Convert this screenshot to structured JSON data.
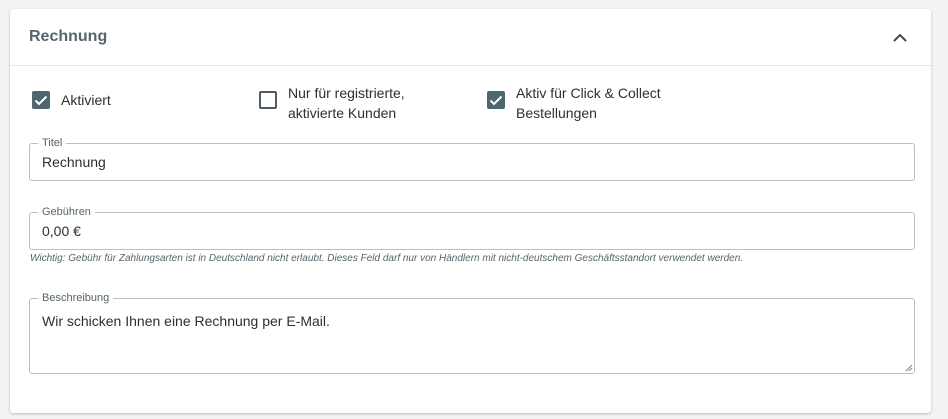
{
  "panel": {
    "title": "Rechnung",
    "collapse_icon": "chevron-up-icon"
  },
  "options": [
    {
      "label": "Aktiviert",
      "checked": true
    },
    {
      "label": "Nur für registrierte, aktivierte Kunden",
      "checked": false
    },
    {
      "label": "Aktiv für Click & Collect Bestellungen",
      "checked": true
    }
  ],
  "fields": {
    "title": {
      "label": "Titel",
      "value": "Rechnung"
    },
    "fees": {
      "label": "Gebühren",
      "value": "0,00 €",
      "hint": "Wichtig: Gebühr für Zahlungsarten ist in Deutschland nicht erlaubt. Dieses Feld darf nur von Händlern mit nicht-deutschem Geschäftsstandort verwendet werden."
    },
    "description": {
      "label": "Beschreibung",
      "value": "Wir schicken Ihnen eine Rechnung per E-Mail."
    }
  },
  "colors": {
    "accent": "#4d6670",
    "title_text": "#54666d",
    "border": "#b6bfc2"
  }
}
